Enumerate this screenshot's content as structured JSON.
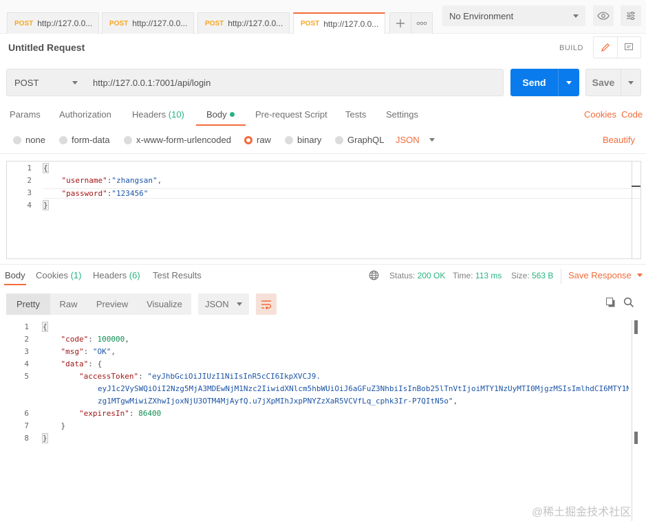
{
  "tabs": [
    {
      "method": "POST",
      "url": "http://127.0.0..."
    },
    {
      "method": "POST",
      "url": "http://127.0.0..."
    },
    {
      "method": "POST",
      "url": "http://127.0.0..."
    },
    {
      "method": "POST",
      "url": "http://127.0.0..."
    }
  ],
  "environment": {
    "selected": "No Environment"
  },
  "request": {
    "title": "Untitled Request",
    "build_label": "BUILD",
    "method": "POST",
    "url": "http://127.0.0.1:7001/api/login",
    "send_label": "Send",
    "save_label": "Save"
  },
  "request_tabs": {
    "params": "Params",
    "authorization": "Authorization",
    "headers": "Headers",
    "headers_count": "(10)",
    "body": "Body",
    "prerequest": "Pre-request Script",
    "tests": "Tests",
    "settings": "Settings",
    "cookies": "Cookies",
    "code": "Code"
  },
  "body_types": {
    "none": "none",
    "form_data": "form-data",
    "urlencoded": "x-www-form-urlencoded",
    "raw": "raw",
    "binary": "binary",
    "graphql": "GraphQL",
    "format": "JSON",
    "beautify": "Beautify"
  },
  "request_body": {
    "line_numbers": [
      "1",
      "2",
      "3",
      "4"
    ],
    "open_brace": "{",
    "username_key": "\"username\"",
    "username_val": "\"zhangsan\"",
    "password_key": "\"password\"",
    "password_val": "\"123456\"",
    "close_brace": "}"
  },
  "response_tabs": {
    "body": "Body",
    "cookies": "Cookies",
    "cookies_count": "(1)",
    "headers": "Headers",
    "headers_count": "(6)",
    "test_results": "Test Results"
  },
  "response_meta": {
    "status_label": "Status:",
    "status_value": "200 OK",
    "time_label": "Time:",
    "time_value": "113 ms",
    "size_label": "Size:",
    "size_value": "563 B",
    "save_response": "Save Response"
  },
  "response_view": {
    "pretty": "Pretty",
    "raw": "Raw",
    "preview": "Preview",
    "visualize": "Visualize",
    "format": "JSON"
  },
  "response_body": {
    "line_numbers": [
      "1",
      "2",
      "3",
      "4",
      "5",
      "6",
      "7",
      "8"
    ],
    "open_brace": "{",
    "code_key": "\"code\"",
    "code_val": "100000",
    "msg_key": "\"msg\"",
    "msg_val": "\"OK\"",
    "data_key": "\"data\"",
    "access_key": "\"accessToken\"",
    "token_line1": "\"eyJhbGciOiJIUzI1NiIsInR5cCI6IkpXVCJ9.",
    "token_line2": "eyJ1c2VySWQiOiI2Nzg5MjA3MDEwNjM1Nzc2IiwidXNlcm5hbWUiOiJ6aGFuZ3NhbiIsInBob25lTnVtIjoiMTY1NzUyMTI0MjgzMSIsImlhdCI6MTY1N",
    "token_line3": "zg1MTgwMiwiZXhwIjoxNjU3OTM4MjAyfQ.u7jXpMIhJxpPNYZzXaR5VCVfLq_cphk3Ir-P7QItN5o\"",
    "expires_key": "\"expiresIn\"",
    "expires_val": "86400",
    "close_inner": "}",
    "close_brace": "}"
  },
  "watermark": "@稀土掘金技术社区",
  "colors": {
    "accent": "#f26b3a",
    "send": "#097bed",
    "success": "#26b47f"
  }
}
